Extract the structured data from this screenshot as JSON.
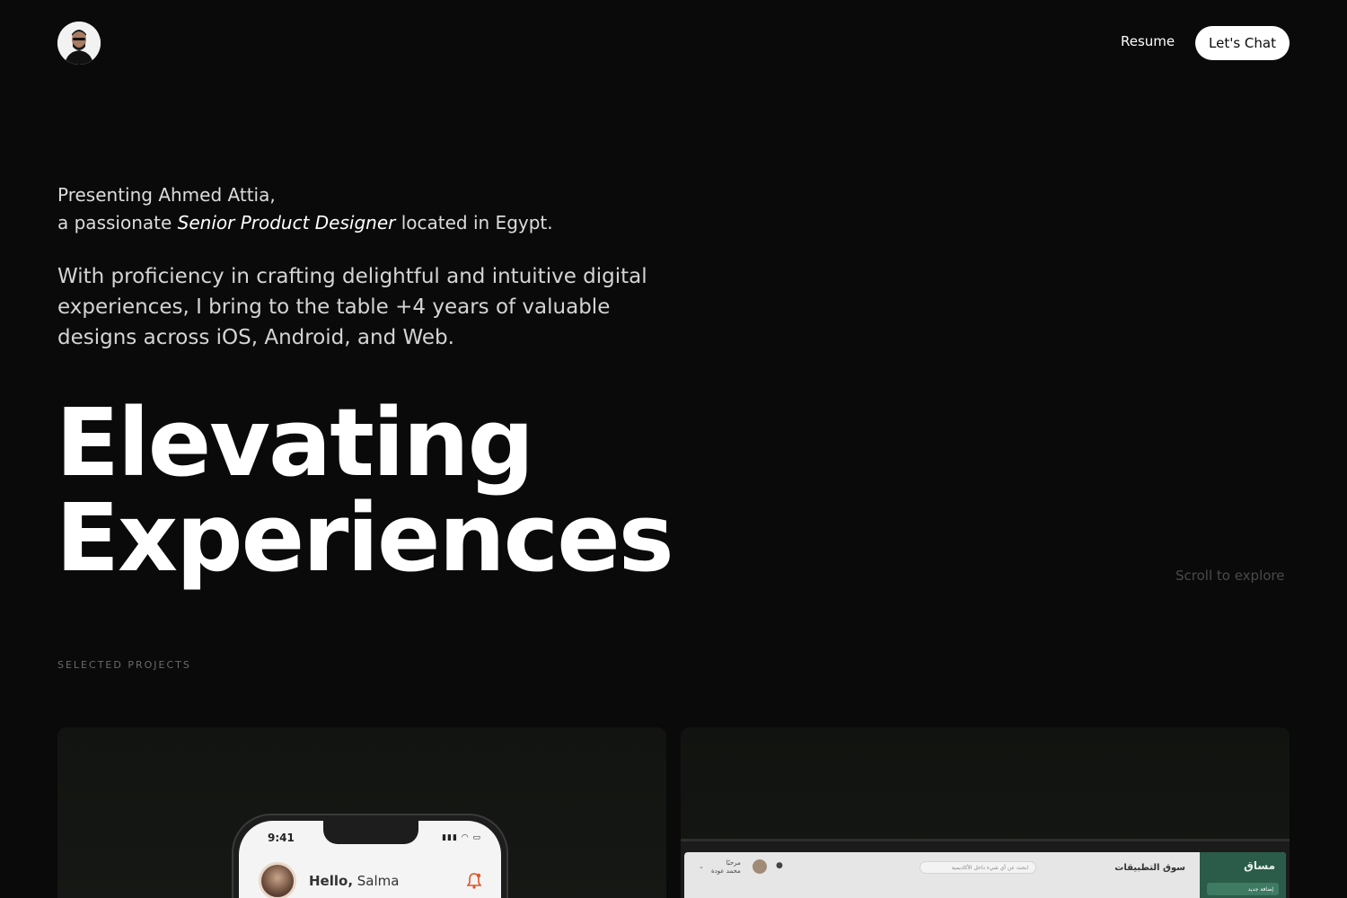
{
  "header": {
    "avatar_alt": "Ahmed Attia",
    "resume_label": "Resume",
    "chat_label": "Let's Chat"
  },
  "intro": {
    "line1": "Presenting Ahmed Attia,",
    "line2_prefix": "a passionate ",
    "line2_role": "Senior Product Designer",
    "line2_suffix": " located in Egypt."
  },
  "bio": "With proficiency in crafting delightful and intuitive digital experiences, I bring to the table +4 years of valuable designs across iOS, Android, and Web.",
  "hero": {
    "line1": "Elevating",
    "line2": "Experiences"
  },
  "scroll_hint": "Scroll to explore",
  "section_label": "SELECTED PROJECTS",
  "projects": {
    "phone": {
      "time": "9:41",
      "status": "▮▮▮ ◠ ▭",
      "hello_bold": "Hello,",
      "hello_name": " Salma",
      "bell_icon": "bell-icon"
    },
    "dashboard": {
      "logo": "مساق",
      "sidebar_button": "إضافة جديد",
      "title": "سوق التطبيقات",
      "search_placeholder": "ابحث عن أي شيء داخل الأكاديمية",
      "user_name_line1": "مرحبًا",
      "user_name_line2": "محمد عودة",
      "chevron": "⌄"
    }
  },
  "colors": {
    "background": "#0a0a0a",
    "text": "#ffffff",
    "muted": "#4a4a4a",
    "dashboard_sidebar": "#2b5c49",
    "bell": "#e0552a"
  }
}
